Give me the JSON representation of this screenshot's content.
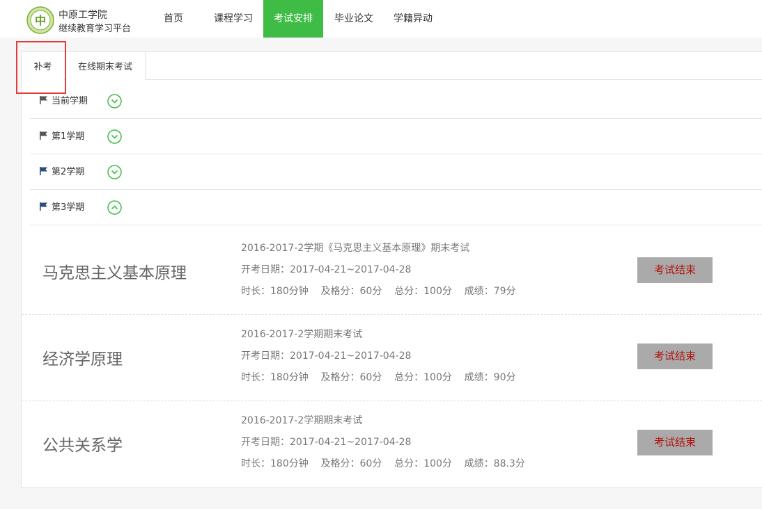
{
  "header": {
    "school_name": "中原工学院",
    "platform_name": "继续教育学习平台",
    "nav": [
      "首页",
      "课程学习",
      "考试安排",
      "毕业论文",
      "学籍异动"
    ],
    "active_nav": "考试安排"
  },
  "tabs": [
    "补考",
    "在线期末考试"
  ],
  "terms": [
    {
      "label": "当前学期",
      "expanded": false
    },
    {
      "label": "第1学期",
      "expanded": false
    },
    {
      "label": "第2学期",
      "expanded": false
    },
    {
      "label": "第3学期",
      "expanded": true
    }
  ],
  "exams": [
    {
      "course": "马克思主义基本原理",
      "title": "2016-2017-2学期《马克思主义基本原理》期末考试",
      "date": "开考日期：2017-04-21~2017-04-28",
      "info": "时长：180分钟    及格分：60分    总分：100分    成绩：79分",
      "button": "考试结束"
    },
    {
      "course": "经济学原理",
      "title": "2016-2017-2学期期末考试",
      "date": "开考日期：2017-04-21~2017-04-28",
      "info": "时长：180分钟    及格分：60分    总分：100分    成绩：90分",
      "button": "考试结束"
    },
    {
      "course": "公共关系学",
      "title": "2016-2017-2学期期末考试",
      "date": "开考日期：2017-04-21~2017-04-28",
      "info": "时长：180分钟    及格分：60分    总分：100分    成绩：88.3分",
      "button": "考试结束"
    }
  ],
  "colors": {
    "accent_green": "#3fbc45",
    "button_gray": "#aaaaaa",
    "button_text_red": "#b1140f",
    "highlight_red": "#e03c3c",
    "flag_dark": "#555555",
    "flag_blue": "#2a4d7a"
  },
  "icons": {
    "logo": "school-seal-logo",
    "flag": "flag-icon",
    "collapsed": "chevron-down-circle-icon",
    "expanded": "chevron-up-circle-icon"
  }
}
